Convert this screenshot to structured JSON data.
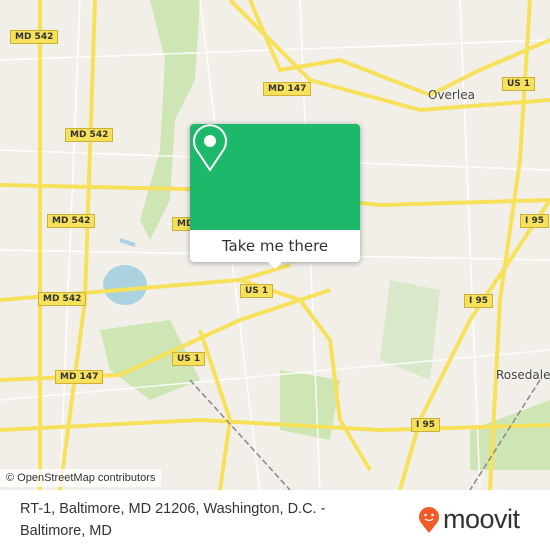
{
  "map": {
    "shields": [
      "MD 542",
      "MD 542",
      "MD 542",
      "MD 542",
      "MD 147",
      "MD 147",
      "US 1",
      "US 1",
      "US 1",
      "I 95",
      "I 95",
      "I 95",
      "MD"
    ],
    "places": [
      "Overlea",
      "Rosedale"
    ],
    "attribution": "© OpenStreetMap contributors",
    "colors": {
      "land": "#f2efe9",
      "park": "#cde6b4",
      "water": "#aad3df",
      "road": "#f7e15a",
      "popup": "#1eb86b"
    }
  },
  "popup": {
    "icon": "map-pin-icon",
    "button_label": "Take me there"
  },
  "footer": {
    "address": "RT-1, Baltimore, MD 21206, Washington, D.C. - Baltimore, MD",
    "logo": "moovit",
    "brand_color": "#f15a29"
  }
}
